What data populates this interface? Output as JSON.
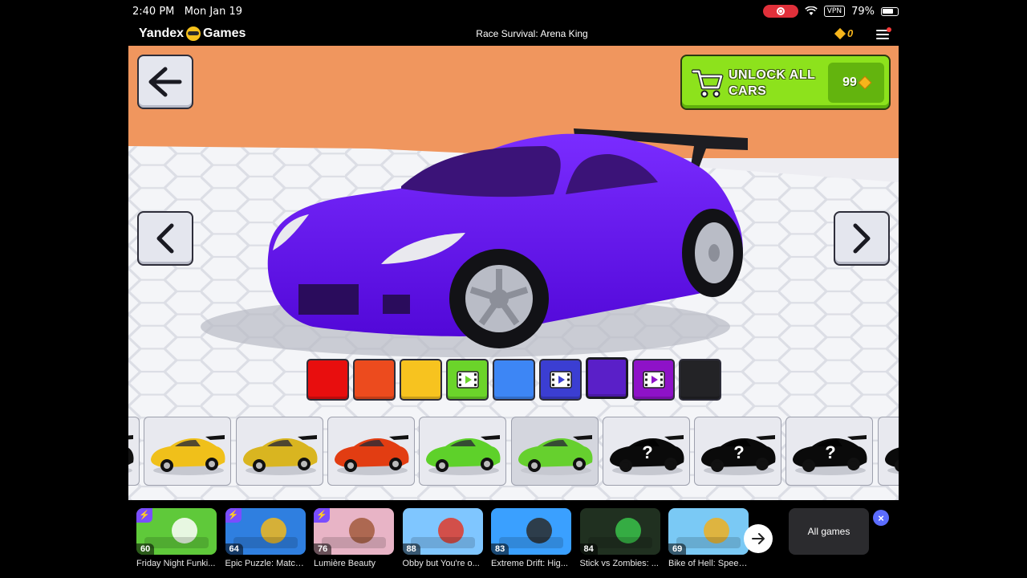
{
  "status_bar": {
    "time": "2:40 PM",
    "date": "Mon Jan 19",
    "vpn": "VPN",
    "battery": "79%",
    "battery_level": 0.79
  },
  "header": {
    "brand": "Yandex",
    "brand_suffix": "Games",
    "game_title": "Race Survival: Arena King",
    "coins": "0"
  },
  "game": {
    "unlock_label": "UNLOCK ALL CARS",
    "unlock_price": "99",
    "colors": {
      "car_body": "#6a12f0",
      "ground": "#f4f5f8",
      "sky": "#f0965e",
      "unlock_green": "#8de21c"
    },
    "swatches": [
      {
        "color": "#e80e0e",
        "video": false,
        "selected": false
      },
      {
        "color": "#ec4b1e",
        "video": false,
        "selected": false
      },
      {
        "color": "#f7c31f",
        "video": false,
        "selected": false
      },
      {
        "color": "#6bd42a",
        "video": true,
        "selected": false
      },
      {
        "color": "#3d86f5",
        "video": false,
        "selected": false
      },
      {
        "color": "#3b3ed2",
        "video": true,
        "selected": false
      },
      {
        "color": "#5a1fc8",
        "video": false,
        "selected": true
      },
      {
        "color": "#8e12c8",
        "video": true,
        "selected": false
      },
      {
        "color": "#232326",
        "video": false,
        "selected": false
      }
    ],
    "cars": [
      {
        "color": "#111111",
        "locked": true,
        "partial": true
      },
      {
        "color": "#f0c01a",
        "locked": false
      },
      {
        "color": "#d9b520",
        "locked": false
      },
      {
        "color": "#e23d12",
        "locked": false
      },
      {
        "color": "#5ed12a",
        "locked": false
      },
      {
        "color": "#66d02e",
        "locked": false,
        "active": true
      },
      {
        "color": "#0a0a0a",
        "locked": true,
        "label": "?"
      },
      {
        "color": "#0a0a0a",
        "locked": true,
        "label": "?"
      },
      {
        "color": "#0a0a0a",
        "locked": true,
        "label": "?"
      },
      {
        "color": "#0a0a0a",
        "locked": true,
        "partial": true
      }
    ]
  },
  "bottom_bar": {
    "games": [
      {
        "name": "Friday Night Funki...",
        "rating": "60",
        "bolt": true,
        "bg": "#5fc93a",
        "accent": "#ffffff"
      },
      {
        "name": "Epic Puzzle: Match...",
        "rating": "64",
        "bolt": true,
        "bg": "#2f7fe0",
        "accent": "#f2b81a"
      },
      {
        "name": "Lumière Beauty",
        "rating": "76",
        "bolt": true,
        "bg": "#e8b4c6",
        "accent": "#a25a3c"
      },
      {
        "name": "Obby but You're o...",
        "rating": "88",
        "bolt": false,
        "bg": "#7fc6ff",
        "accent": "#e03a2a"
      },
      {
        "name": "Extreme Drift: Hig...",
        "rating": "83",
        "bolt": false,
        "bg": "#3aa0ff",
        "accent": "#2c2c2c"
      },
      {
        "name": "Stick vs Zombies: ...",
        "rating": "84",
        "bolt": false,
        "bg": "#203020",
        "accent": "#3ac24a"
      },
      {
        "name": "Bike of Hell: Speed...",
        "rating": "69",
        "bolt": false,
        "bg": "#7ac9f5",
        "accent": "#f0b020"
      }
    ],
    "all_games": "All games",
    "close": "×"
  }
}
